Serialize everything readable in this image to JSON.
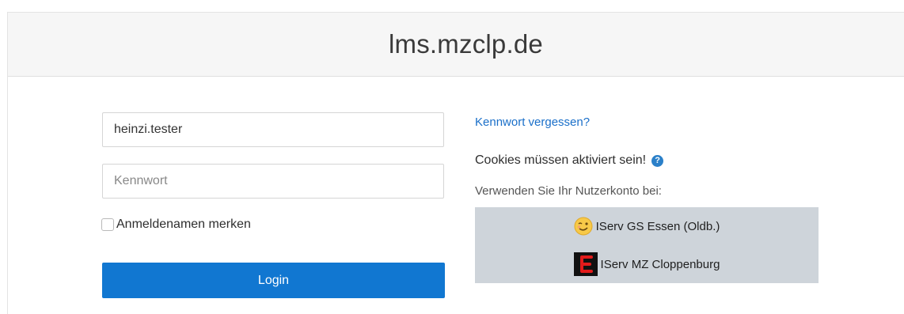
{
  "page": {
    "title": "lms.mzclp.de"
  },
  "login": {
    "username_value": "heinzi.tester",
    "password_placeholder": "Kennwort",
    "remember_label": "Anmeldenamen merken",
    "login_button": "Login"
  },
  "side": {
    "forgot_link": "Kennwort vergessen?",
    "cookies_text": "Cookies müssen aktiviert sein!",
    "use_account_text": "Verwenden Sie Ihr Nutzerkonto bei:",
    "identity_providers": [
      {
        "label": "IServ GS Essen (Oldb.)",
        "icon": "smiley-logo-icon"
      },
      {
        "label": "IServ MZ Cloppenburg",
        "icon": "iserv-mz-logo-icon"
      }
    ]
  },
  "colors": {
    "primary": "#1177d1",
    "link": "#1a6fc9",
    "idp_background": "#ced4da",
    "header_background": "#f6f6f6"
  }
}
